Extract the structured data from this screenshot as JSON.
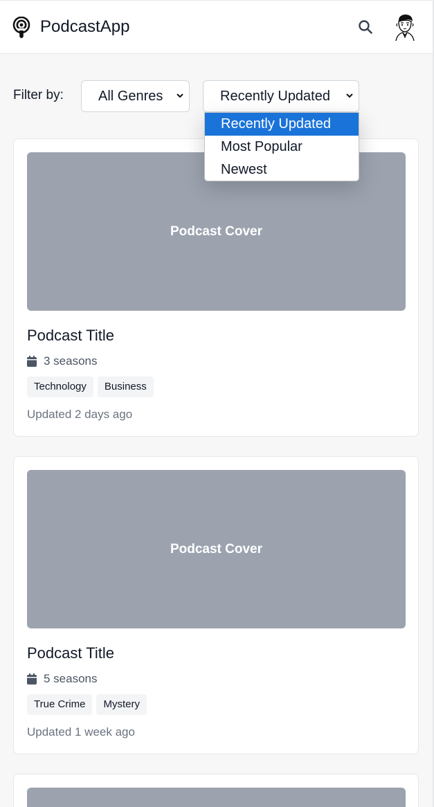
{
  "header": {
    "app_title": "PodcastApp",
    "logo_icon": "podcast-icon",
    "search_icon": "search-icon",
    "avatar_icon": "avatar"
  },
  "filters": {
    "label": "Filter by:",
    "genre_select": {
      "value": "All Genres"
    },
    "sort_select": {
      "value": "Recently Updated",
      "options": [
        "Recently Updated",
        "Most Popular",
        "Newest"
      ],
      "highlighted": "Recently Updated"
    }
  },
  "podcasts": [
    {
      "cover_label": "Podcast Cover",
      "title": "Podcast Title",
      "seasons": "3 seasons",
      "tags": [
        "Technology",
        "Business"
      ],
      "updated": "Updated 2 days ago"
    },
    {
      "cover_label": "Podcast Cover",
      "title": "Podcast Title",
      "seasons": "5 seasons",
      "tags": [
        "True Crime",
        "Mystery"
      ],
      "updated": "Updated 1 week ago"
    }
  ],
  "colors": {
    "accent": "#1a73d9",
    "cover": "#9ca3af",
    "background": "#f7f7f7"
  }
}
